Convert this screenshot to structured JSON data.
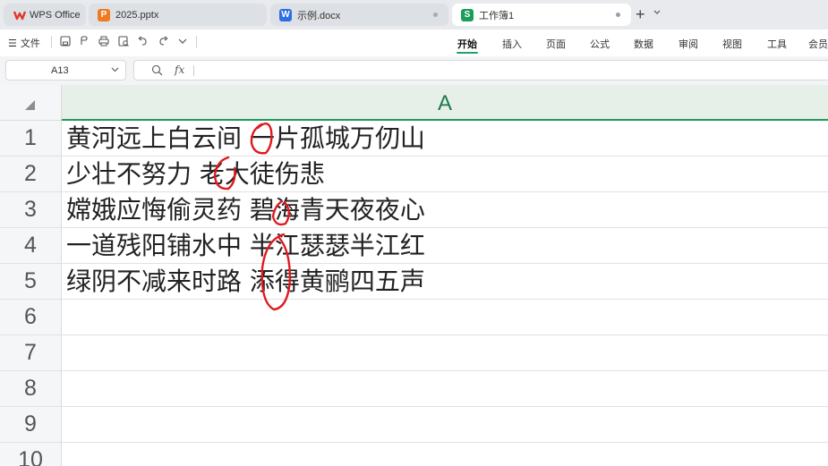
{
  "tabs": [
    {
      "label": "WPS Office",
      "logo": "wps-logo-icon",
      "color": "#e5352b"
    },
    {
      "label": "2025.pptx",
      "logo": "P",
      "color": "#f07a22"
    },
    {
      "label": "示例.docx",
      "logo": "W",
      "color": "#2b6fe0"
    },
    {
      "label": "工作簿1",
      "logo": "S",
      "color": "#1e9c5a"
    }
  ],
  "new_tab_label": "+",
  "file_menu": {
    "icon": "hamburger-icon",
    "label": "文件"
  },
  "ribbon_tabs": [
    "开始",
    "插入",
    "页面",
    "公式",
    "数据",
    "审阅",
    "视图",
    "工具",
    "会员"
  ],
  "active_ribbon_tab": "开始",
  "name_box": "A13",
  "formula_value": "",
  "fx_label": "fx",
  "column_header": "A",
  "row_numbers": [
    "1",
    "2",
    "3",
    "4",
    "5",
    "6",
    "7",
    "8",
    "9",
    "10"
  ],
  "cells": [
    "黄河远上白云间 一片孤城万仞山",
    "少壮不努力 老大徒伤悲",
    "嫦娥应悔偷灵药 碧海青天夜夜心",
    "一道残阳铺水中 半江瑟瑟半江红",
    "绿阴不减来时路 添得黄鹂四五声"
  ],
  "colors": {
    "accent": "#1e9c5a",
    "annotation": "#e0191f"
  }
}
